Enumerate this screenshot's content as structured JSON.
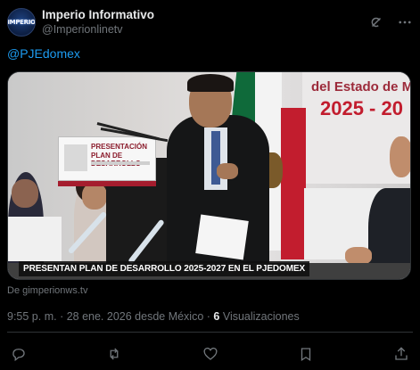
{
  "author": {
    "display_name": "Imperio Informativo",
    "handle": "@Imperionlinetv",
    "avatar_text": "IMPERIO"
  },
  "header_actions": [
    {
      "name": "grok-icon"
    },
    {
      "name": "more-icon"
    }
  ],
  "tweet": {
    "text": "@PJEdomex"
  },
  "media": {
    "banner_line1": "del Estado de M",
    "banner_line2": "2025 - 20",
    "card_line1": "PRESENTACIÓN",
    "card_line2": "PLAN DE DESARROLLO",
    "caption": "PRESENTAN PLAN DE DESARROLLO 2025-2027 EN EL PJEDOMEX"
  },
  "source": "De gimperionws.tv",
  "meta": {
    "time": "9:55 p. m.",
    "sep1": " · ",
    "date": "28 ene. 2026 desde México",
    "sep2": " · ",
    "views_count": "6",
    "views_label": " Visualizaciones"
  },
  "actions": [
    {
      "name": "reply-icon"
    },
    {
      "name": "retweet-icon"
    },
    {
      "name": "like-icon"
    },
    {
      "name": "bookmark-icon"
    },
    {
      "name": "share-icon"
    }
  ],
  "colors": {
    "background": "#000000",
    "text": "#e7e9ea",
    "muted": "#71767b",
    "accent": "#1d9bf0"
  }
}
